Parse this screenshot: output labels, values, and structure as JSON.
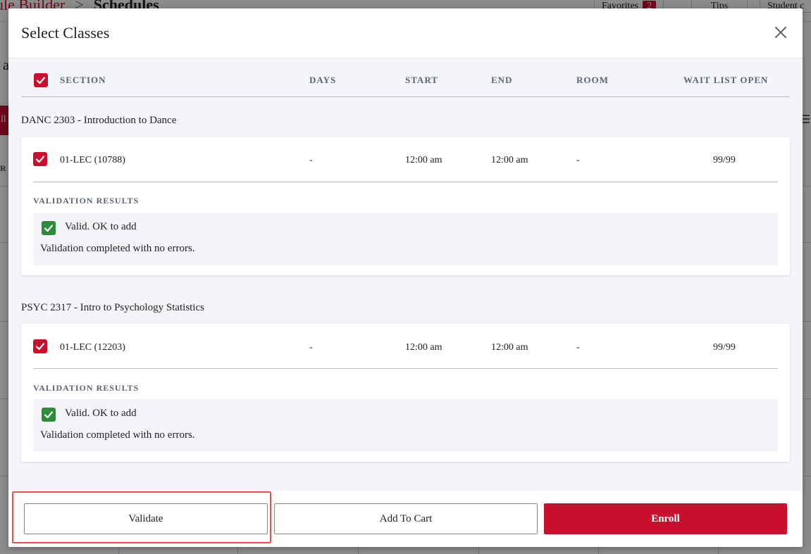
{
  "background": {
    "app_name": "ule Builder",
    "separator": ">",
    "current_page": "Schedules",
    "favorites_label": "Favorites",
    "favorites_count": "2",
    "tips_label": "Tips",
    "student_label": "Student c",
    "side_letter": "a",
    "side_tab_letter": "ll",
    "side_r": "R"
  },
  "modal": {
    "title": "Select Classes",
    "close_icon": "close-icon",
    "columns": {
      "section": "SECTION",
      "days": "DAYS",
      "start": "START",
      "end": "END",
      "room": "ROOM",
      "wait_list": "WAIT LIST OPEN"
    },
    "courses": [
      {
        "title": "DANC 2303 - Introduction to Dance",
        "section": "01-LEC (10788)",
        "days": "-",
        "start": "12:00 am",
        "end": "12:00 am",
        "room": "-",
        "wait_list": "99/99",
        "validation_label": "VALIDATION RESULTS",
        "validation_status": "Valid. OK to add",
        "validation_message": "Validation completed with no errors."
      },
      {
        "title": "PSYC 2317 - Intro to Psychology Statistics",
        "section": "01-LEC (12203)",
        "days": "-",
        "start": "12:00 am",
        "end": "12:00 am",
        "room": "-",
        "wait_list": "99/99",
        "validation_label": "VALIDATION RESULTS",
        "validation_status": "Valid. OK to add",
        "validation_message": "Validation completed with no errors."
      }
    ],
    "footer": {
      "validate_label": "Validate",
      "add_to_cart_label": "Add To Cart",
      "enroll_label": "Enroll"
    }
  },
  "colors": {
    "brand_red": "#c8102e",
    "valid_green": "#2e8b3a",
    "highlight": "#e8534a"
  }
}
